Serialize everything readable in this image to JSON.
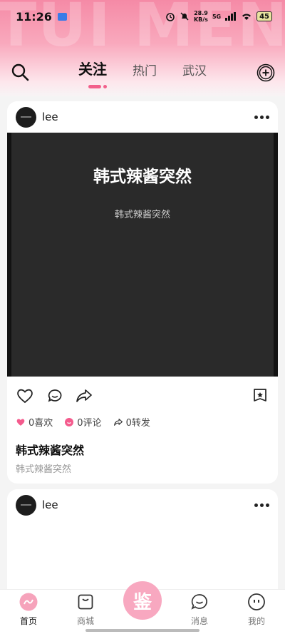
{
  "status_bar": {
    "time": "11:26",
    "net_speed_value": "28.9",
    "net_speed_unit": "KB/s",
    "network": "5G",
    "battery": "45"
  },
  "brand_watermark": "TUI MENG",
  "nav": {
    "tabs": [
      "关注",
      "热门",
      "武汉"
    ],
    "active_tab": 0
  },
  "posts": [
    {
      "username": "lee",
      "media_title": "韩式辣酱突然",
      "media_subtitle": "韩式辣酱突然",
      "likes": "0喜欢",
      "comments": "0评论",
      "shares": "0转发",
      "title": "韩式辣酱突然",
      "description": "韩式辣酱突然"
    },
    {
      "username": "lee"
    }
  ],
  "tabbar": {
    "items": [
      "首页",
      "商城",
      "消息",
      "我的"
    ],
    "center_label": "鉴",
    "active": 0
  },
  "colors": {
    "accent": "#f2608b",
    "like_pink": "#f45b8d",
    "center_button": "#f8a8c0"
  }
}
